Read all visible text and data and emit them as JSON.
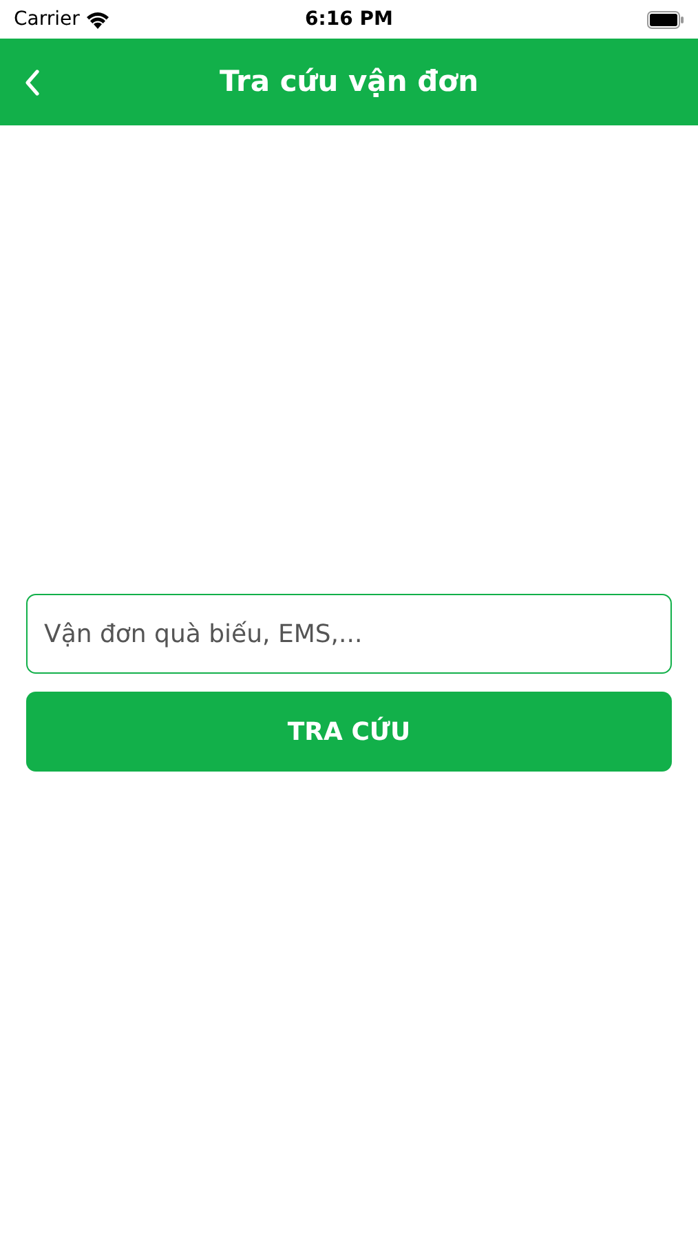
{
  "status_bar": {
    "carrier": "Carrier",
    "time": "6:16 PM"
  },
  "header": {
    "title": "Tra cứu vận đơn"
  },
  "search": {
    "placeholder": "Vận đơn quà biếu, EMS,..."
  },
  "button": {
    "label": "TRA CỨU"
  }
}
